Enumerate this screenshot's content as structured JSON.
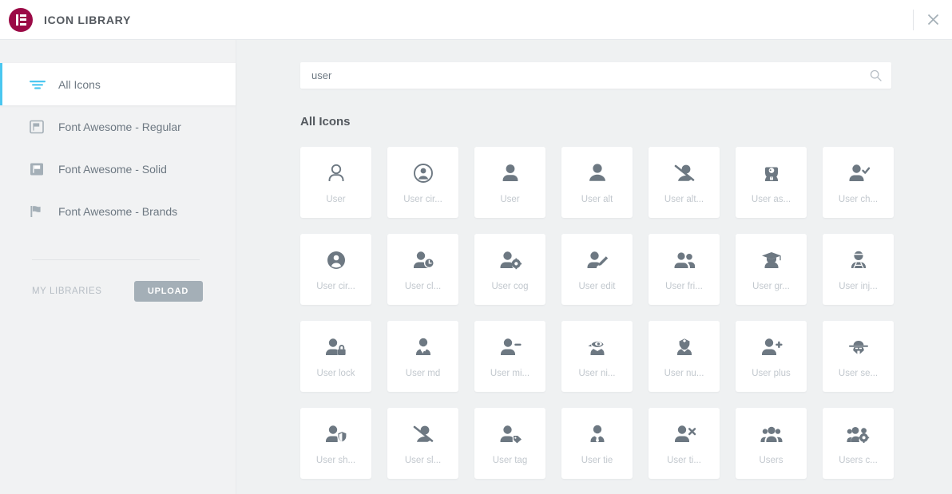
{
  "header": {
    "title": "ICON LIBRARY",
    "logo_color": "#9b0a46",
    "logo_icon": "elementor-logo-icon",
    "close_icon": "close-icon"
  },
  "sidebar": {
    "accent_color": "#4bc7f0",
    "items": [
      {
        "label": "All Icons",
        "icon": "filter-icon",
        "active": true
      },
      {
        "label": "Font Awesome - Regular",
        "icon": "flag-regular-icon",
        "active": false
      },
      {
        "label": "Font Awesome - Solid",
        "icon": "flag-solid-icon",
        "active": false
      },
      {
        "label": "Font Awesome - Brands",
        "icon": "flag-brands-icon",
        "active": false
      }
    ],
    "my_libraries_label": "MY LIBRARIES",
    "upload_label": "UPLOAD"
  },
  "search": {
    "value": "user",
    "placeholder": "",
    "icon": "search-icon"
  },
  "main": {
    "section_title": "All Icons",
    "icons": [
      {
        "label": "User",
        "glyph": "user-regular"
      },
      {
        "label": "User cir...",
        "glyph": "user-circle-regular"
      },
      {
        "label": "User",
        "glyph": "user-solid"
      },
      {
        "label": "User alt",
        "glyph": "user-alt"
      },
      {
        "label": "User alt...",
        "glyph": "user-alt-slash"
      },
      {
        "label": "User as...",
        "glyph": "user-astronaut"
      },
      {
        "label": "User ch...",
        "glyph": "user-check"
      },
      {
        "label": "User cir...",
        "glyph": "user-circle-solid"
      },
      {
        "label": "User cl...",
        "glyph": "user-clock"
      },
      {
        "label": "User cog",
        "glyph": "user-cog"
      },
      {
        "label": "User edit",
        "glyph": "user-edit"
      },
      {
        "label": "User fri...",
        "glyph": "user-friends"
      },
      {
        "label": "User gr...",
        "glyph": "user-graduate"
      },
      {
        "label": "User inj...",
        "glyph": "user-injured"
      },
      {
        "label": "User lock",
        "glyph": "user-lock"
      },
      {
        "label": "User md",
        "glyph": "user-md"
      },
      {
        "label": "User mi...",
        "glyph": "user-minus"
      },
      {
        "label": "User ni...",
        "glyph": "user-ninja"
      },
      {
        "label": "User nu...",
        "glyph": "user-nurse"
      },
      {
        "label": "User plus",
        "glyph": "user-plus"
      },
      {
        "label": "User se...",
        "glyph": "user-secret"
      },
      {
        "label": "User sh...",
        "glyph": "user-shield"
      },
      {
        "label": "User sl...",
        "glyph": "user-slash"
      },
      {
        "label": "User tag",
        "glyph": "user-tag"
      },
      {
        "label": "User tie",
        "glyph": "user-tie"
      },
      {
        "label": "User ti...",
        "glyph": "user-times"
      },
      {
        "label": "Users",
        "glyph": "users"
      },
      {
        "label": "Users c...",
        "glyph": "users-cog"
      }
    ]
  }
}
